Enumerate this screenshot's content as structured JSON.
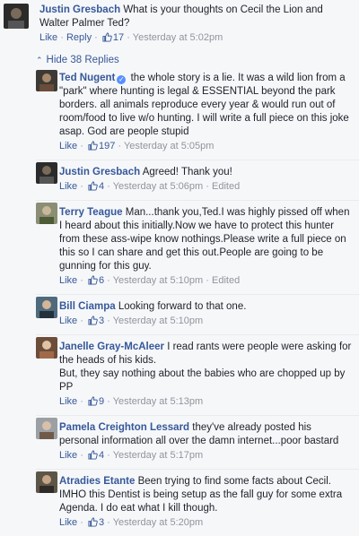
{
  "top_comment": {
    "author": "Justin Gresbach",
    "text": "What is your thoughts on Cecil the Lion and Walter Palmer Ted?",
    "like": "Like",
    "reply": "Reply",
    "likes": "17",
    "time": "Yesterday at 5:02pm"
  },
  "hide_replies": "Hide 38 Replies",
  "replies": [
    {
      "author": "Ted Nugent",
      "text": "the whole story is a lie. It was a wild lion from a \"park\" where hunting is legal & ESSENTIAL beyond the park borders. all animals reproduce every year & would run out of room/food to live w/o hunting. I will write a full piece on this joke asap. God are people stupid",
      "like": "Like",
      "likes": "197",
      "time": "Yesterday at 5:05pm",
      "edited": "",
      "verified": true
    },
    {
      "author": "Justin Gresbach",
      "text": "Agreed! Thank you!",
      "like": "Like",
      "likes": "4",
      "time": "Yesterday at 5:06pm",
      "edited": "Edited"
    },
    {
      "author": "Terry Teague",
      "text": "Man...thank you,Ted.I was highly pissed off when I heard about this initially.Now we have to protect this hunter from these ass-wipe know nothings.Please write a full piece on this so I can share and get this out.People are going to be gunning for this guy.",
      "like": "Like",
      "likes": "6",
      "time": "Yesterday at 5:10pm",
      "edited": "Edited"
    },
    {
      "author": "Bill Ciampa",
      "text": "Looking forward to that one.",
      "like": "Like",
      "likes": "3",
      "time": "Yesterday at 5:10pm",
      "edited": ""
    },
    {
      "author": "Janelle Gray-McAleer",
      "text": "I read rants were people were asking for the heads of his kids.",
      "text2": "But, they say nothing about the babies who are chopped up by PP",
      "like": "Like",
      "likes": "9",
      "time": "Yesterday at 5:13pm",
      "edited": ""
    },
    {
      "author": "Pamela Creighton Lessard",
      "text": "they've already posted his personal information all over the damn internet...poor bastard",
      "like": "Like",
      "likes": "4",
      "time": "Yesterday at 5:17pm",
      "edited": ""
    },
    {
      "author": "Atradies Etante",
      "text": "Been trying to find some facts about Cecil. IMHO this Dentist is being setup as the fall guy for some extra Agenda. I do eat what I kill though.",
      "like": "Like",
      "likes": "3",
      "time": "Yesterday at 5:20pm",
      "edited": ""
    }
  ],
  "colors": {
    "link": "#365899",
    "meta": "#90949c",
    "background": "#f6f7f9"
  }
}
